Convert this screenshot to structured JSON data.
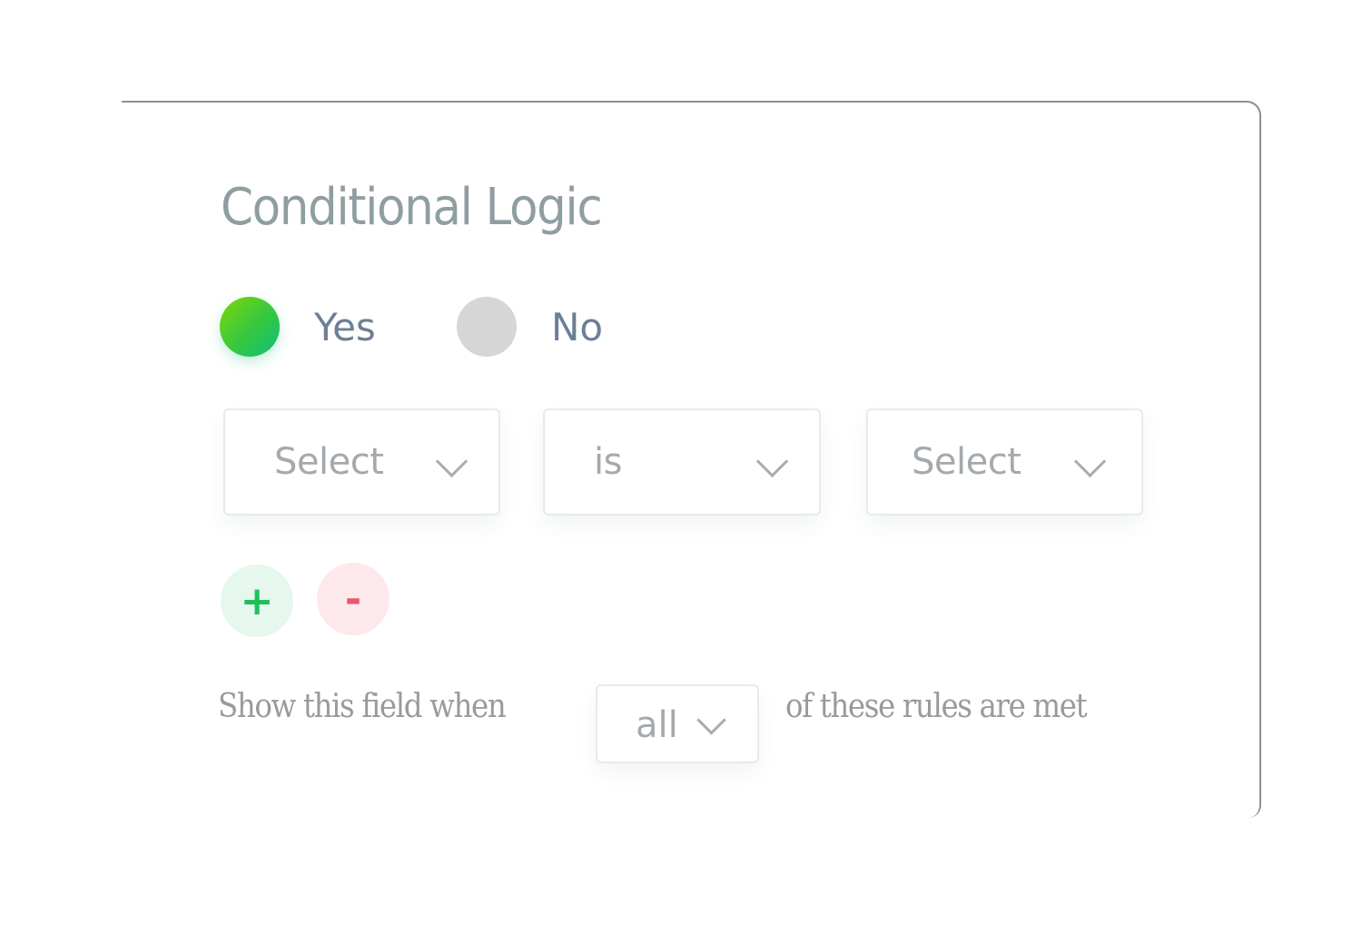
{
  "panel": {
    "title": "Conditional Logic",
    "toggle": {
      "options": [
        {
          "label": "Yes",
          "selected": true
        },
        {
          "label": "No",
          "selected": false
        }
      ]
    },
    "rule": {
      "field_select": {
        "value": "Select"
      },
      "operator_select": {
        "value": "is"
      },
      "value_select": {
        "value": "Select"
      }
    },
    "buttons": {
      "add_label": "+",
      "remove_label": "-"
    },
    "match": {
      "prefix": "Show this field when",
      "selected": "all",
      "suffix": "of these rules are met"
    }
  },
  "colors": {
    "accent_green": "#1fc05c",
    "remove_red": "#e8576f",
    "title_gray": "#8f9ea0"
  }
}
